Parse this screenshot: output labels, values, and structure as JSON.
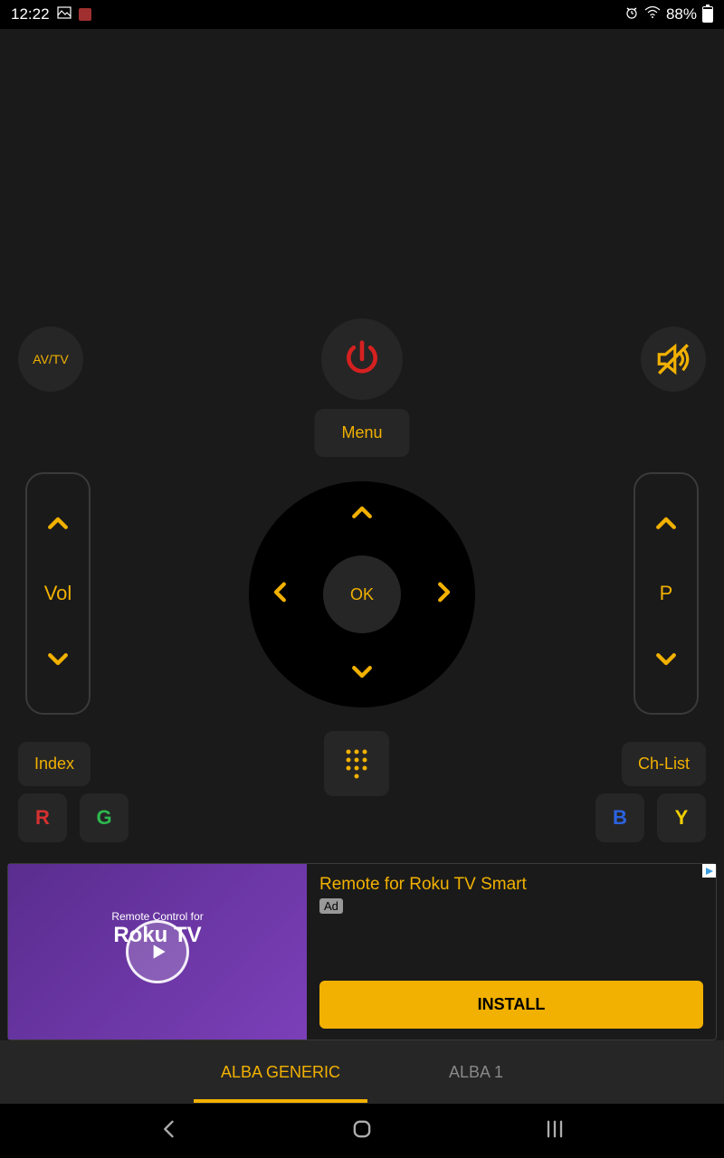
{
  "status": {
    "time": "12:22",
    "battery": "88%"
  },
  "buttons": {
    "avtv": "AV/TV",
    "menu": "Menu",
    "vol_label": "Vol",
    "prog_label": "P",
    "ok": "OK",
    "index": "Index",
    "chlist": "Ch-List",
    "r": "R",
    "g": "G",
    "b": "B",
    "y": "Y"
  },
  "ad": {
    "thumb_sub": "Remote Control for",
    "thumb_title": "Roku TV",
    "title": "Remote for Roku TV Smart",
    "badge": "Ad",
    "cta": "INSTALL"
  },
  "tabs": {
    "t1": "ALBA GENERIC",
    "t2": "ALBA 1"
  },
  "colors": {
    "r": "#d63030",
    "g": "#2db84d",
    "b": "#2b62e0",
    "y": "#f2d000"
  }
}
